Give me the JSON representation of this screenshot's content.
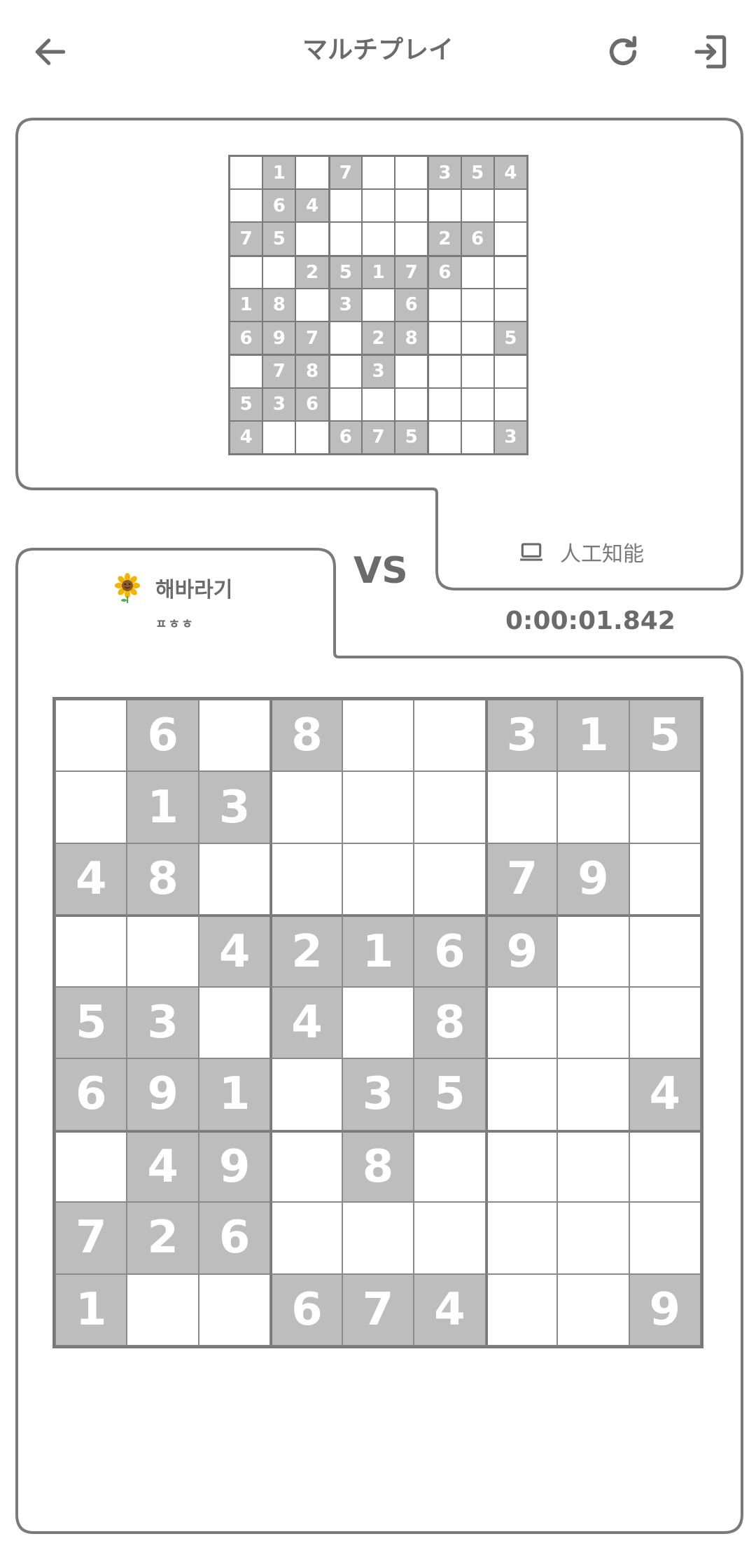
{
  "header": {
    "title": "マルチプレイ",
    "back_icon": "arrow-left-icon",
    "refresh_icon": "refresh-icon",
    "exit_icon": "exit-icon"
  },
  "opponent": {
    "name": "人工知能",
    "icon": "laptop-icon",
    "board": [
      [
        "",
        "1",
        "",
        "7",
        "",
        "",
        "3",
        "5",
        "4"
      ],
      [
        "",
        "6",
        "4",
        "",
        "",
        "",
        "",
        "",
        ""
      ],
      [
        "7",
        "5",
        "",
        "",
        "",
        "",
        "2",
        "6",
        ""
      ],
      [
        "",
        "",
        "2",
        "5",
        "1",
        "7",
        "6",
        "",
        ""
      ],
      [
        "1",
        "8",
        "",
        "3",
        "",
        "6",
        "",
        "",
        ""
      ],
      [
        "6",
        "9",
        "7",
        "",
        "2",
        "8",
        "",
        "",
        "5"
      ],
      [
        "",
        "7",
        "8",
        "",
        "3",
        "",
        "",
        "",
        ""
      ],
      [
        "5",
        "3",
        "6",
        "",
        "",
        "",
        "",
        "",
        ""
      ],
      [
        "4",
        "",
        "",
        "6",
        "7",
        "5",
        "",
        "",
        "3"
      ]
    ]
  },
  "vs_label": "VS",
  "player": {
    "name": "해바라기",
    "avatar_icon": "sunflower-icon",
    "subtitle": "ㅍㅎㅎ",
    "board": [
      [
        "",
        "6",
        "",
        "8",
        "",
        "",
        "3",
        "1",
        "5"
      ],
      [
        "",
        "1",
        "3",
        "",
        "",
        "",
        "",
        "",
        ""
      ],
      [
        "4",
        "8",
        "",
        "",
        "",
        "",
        "7",
        "9",
        ""
      ],
      [
        "",
        "",
        "4",
        "2",
        "1",
        "6",
        "9",
        "",
        ""
      ],
      [
        "5",
        "3",
        "",
        "4",
        "",
        "8",
        "",
        "",
        ""
      ],
      [
        "6",
        "9",
        "1",
        "",
        "3",
        "5",
        "",
        "",
        "4"
      ],
      [
        "",
        "4",
        "9",
        "",
        "8",
        "",
        "",
        "",
        ""
      ],
      [
        "7",
        "2",
        "6",
        "",
        "",
        "",
        "",
        "",
        ""
      ],
      [
        "1",
        "",
        "",
        "6",
        "7",
        "4",
        "",
        "",
        "9"
      ]
    ]
  },
  "timer": "0:00:01.842",
  "colors": {
    "frame": "#7a7a7a",
    "given_cell": "#bdbdbd",
    "text": "#6b6b6b"
  }
}
